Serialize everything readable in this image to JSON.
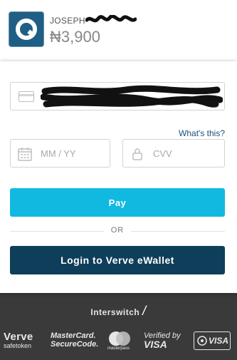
{
  "header": {
    "merchant_name": "JOSEPH-",
    "amount": "₦3,900"
  },
  "form": {
    "card_number_placeholder": "",
    "whats_this": "What's this?",
    "expiry_placeholder": "MM / YY",
    "cvv_placeholder": "CVV",
    "pay_label": "Pay",
    "or_label": "OR",
    "verve_label": "Login to Verve eWallet"
  },
  "footer": {
    "brand": "Interswitch",
    "badges": {
      "verve": "Verve",
      "verve_sub": "safetoken",
      "mastercard_line1": "MasterCard.",
      "mastercard_line2": "SecureCode.",
      "masterpass": "masterpass",
      "vbv_line1": "Verified by",
      "vbv_line2": "VISA",
      "safetoken_visa": "VISA"
    }
  },
  "colors": {
    "accent": "#11b9e1",
    "verve_button": "#0f3e5a",
    "link": "#1a4f78",
    "footer_bg": "#3a3a3a"
  },
  "icons": [
    "quickteller-logo-icon",
    "card-icon",
    "calendar-icon",
    "lock-icon",
    "interswitch-slash-icon"
  ]
}
